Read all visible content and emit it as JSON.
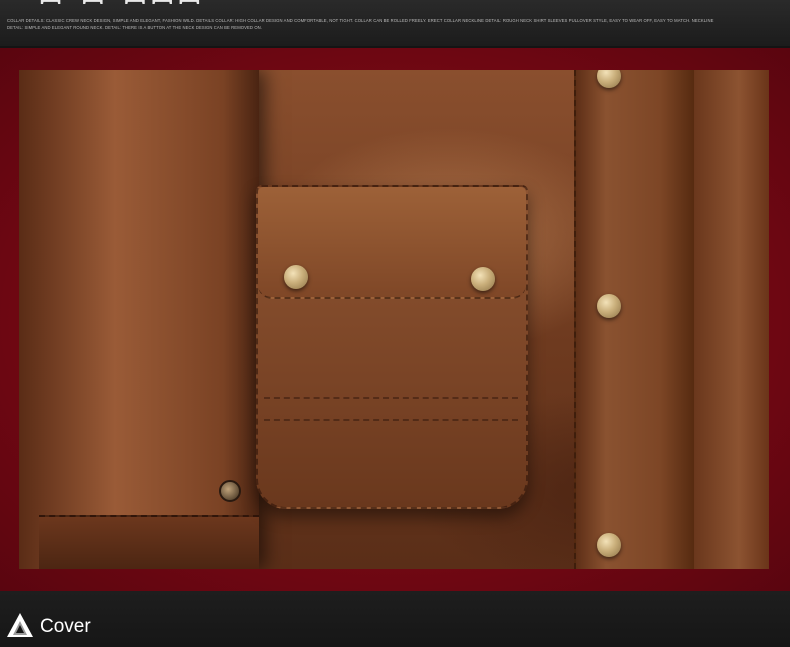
{
  "header": {
    "title_fragment": "ꟷ ꟷ ꟷꟷꟷ",
    "description": "Collar details: classic crew neck design, simple and elegant, fashion wild. Details collar: high collar design and comfortable, not tight. Collar can be rolled freely. Erect collar neckline detail: rough neck shirt sleeves pullover style, easy to wear off, easy to match. Neckline detail: simple and elegant round neck. Detail: there is a button at the neck design can be removed on."
  },
  "product_image": {
    "alt": "Brown leather jacket close-up with flap pocket and snap buttons",
    "colors": {
      "frame": "#7d0a16",
      "leather": "#7a4426",
      "snap": "#c9ae7a"
    }
  },
  "footer": {
    "icon": "peak-triangle-icon",
    "label": "Cover"
  }
}
